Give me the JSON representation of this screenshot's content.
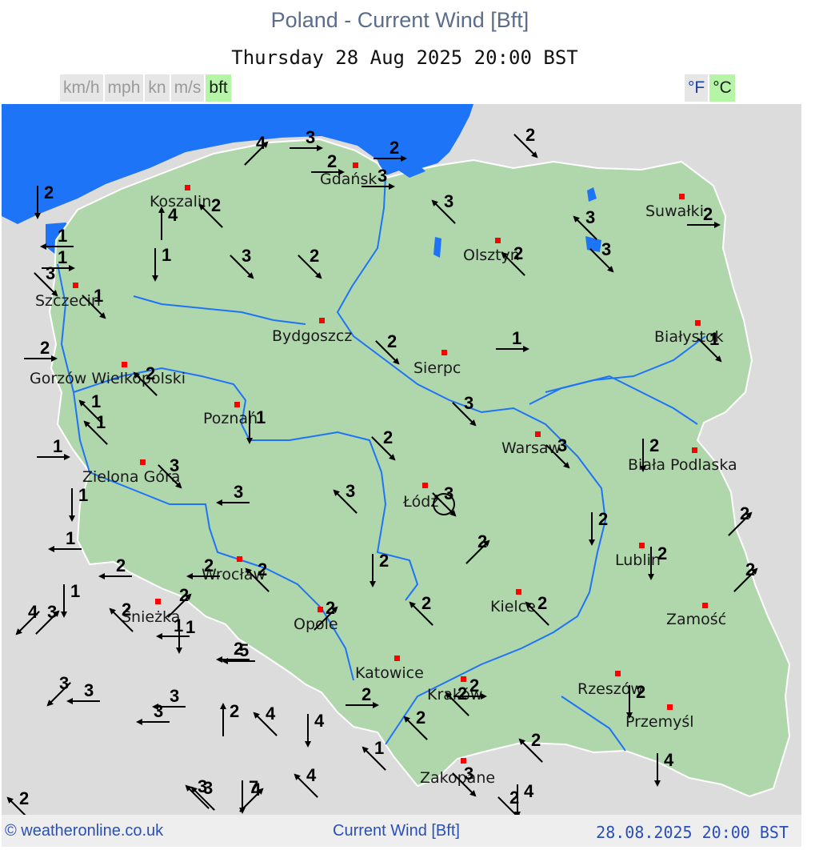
{
  "header": {
    "title": "Poland - Current Wind [Bft]",
    "datetime": "Thursday 28 Aug 2025 20:00 BST"
  },
  "units": [
    {
      "label": "km/h",
      "active": false
    },
    {
      "label": "mph",
      "active": false
    },
    {
      "label": "kn",
      "active": false
    },
    {
      "label": "m/s",
      "active": false
    },
    {
      "label": "bft",
      "active": true
    }
  ],
  "temperature_units": [
    {
      "label": "°F",
      "active": false
    },
    {
      "label": "°C",
      "active": true
    }
  ],
  "colors": {
    "land_poland": "#b0d6ac",
    "land_other": "#dcdcdc",
    "sea": "#1e74f6",
    "border": "#ffffff",
    "river": "#1e74f6",
    "city_marker": "#ff0000",
    "unit_active": "#b6f5a8"
  },
  "cities": [
    {
      "name": "Koszalin"
    },
    {
      "name": "Gdańsk"
    },
    {
      "name": "Suwałki"
    },
    {
      "name": "Olsztyn"
    },
    {
      "name": "Szczecin"
    },
    {
      "name": "Bydgoszcz"
    },
    {
      "name": "Białystok"
    },
    {
      "name": "Sierpc"
    },
    {
      "name": "Gorzów Wielkopolski"
    },
    {
      "name": "Poznań"
    },
    {
      "name": "Warsaw"
    },
    {
      "name": "Biała Podlaska"
    },
    {
      "name": "Zielona Góra"
    },
    {
      "name": "Łódź"
    },
    {
      "name": "Lublin"
    },
    {
      "name": "Wrocław"
    },
    {
      "name": "Śnieżka"
    },
    {
      "name": "Opole"
    },
    {
      "name": "Kielce"
    },
    {
      "name": "Zamość"
    },
    {
      "name": "Katowice"
    },
    {
      "name": "Kraków"
    },
    {
      "name": "Rzeszów"
    },
    {
      "name": "Przemyśl"
    },
    {
      "name": "Zakopane"
    }
  ],
  "wind_observations": [
    {
      "bft": "2",
      "direction": "SE"
    },
    {
      "bft": "3",
      "direction": "E"
    },
    {
      "bft": "4",
      "direction": "NE"
    },
    {
      "bft": "2",
      "direction": "E"
    },
    {
      "bft": "2",
      "direction": "E"
    },
    {
      "bft": "3",
      "direction": "E"
    },
    {
      "bft": "2",
      "direction": "S"
    },
    {
      "bft": "3",
      "direction": "NW"
    },
    {
      "bft": "4",
      "direction": "N"
    },
    {
      "bft": "2",
      "direction": "NW"
    },
    {
      "bft": "3",
      "direction": "NW"
    },
    {
      "bft": "2",
      "direction": "E"
    },
    {
      "bft": "1",
      "direction": "W"
    },
    {
      "bft": "1",
      "direction": "E"
    },
    {
      "bft": "2",
      "direction": "NW"
    },
    {
      "bft": "3",
      "direction": "SE"
    },
    {
      "bft": "3",
      "direction": "SE"
    },
    {
      "bft": "2",
      "direction": "SE"
    },
    {
      "bft": "3",
      "direction": "SE"
    },
    {
      "bft": "1",
      "direction": "SE"
    },
    {
      "bft": "1",
      "direction": "S"
    },
    {
      "bft": "2",
      "direction": "SE"
    },
    {
      "bft": "1",
      "direction": "E"
    },
    {
      "bft": "2",
      "direction": "E"
    },
    {
      "bft": "1",
      "direction": "SE"
    },
    {
      "bft": "2",
      "direction": "NW"
    },
    {
      "bft": "1",
      "direction": "NW"
    },
    {
      "bft": "1",
      "direction": "NW"
    },
    {
      "bft": "1",
      "direction": "S"
    },
    {
      "bft": "3",
      "direction": "SE"
    },
    {
      "bft": "2",
      "direction": "SE"
    },
    {
      "bft": "3",
      "direction": "SE"
    },
    {
      "bft": "1",
      "direction": "E"
    },
    {
      "bft": "3",
      "direction": "NW"
    },
    {
      "bft": "2",
      "direction": "S"
    },
    {
      "bft": "1",
      "direction": "S"
    },
    {
      "bft": "3",
      "direction": "W"
    },
    {
      "bft": "3",
      "direction": "SE"
    },
    {
      "bft": "3",
      "direction": "SE"
    },
    {
      "bft": "2",
      "direction": "NE"
    },
    {
      "bft": "2",
      "direction": "NE"
    },
    {
      "bft": "1",
      "direction": "W"
    },
    {
      "bft": "2",
      "direction": "W"
    },
    {
      "bft": "2",
      "direction": "NW"
    },
    {
      "bft": "2",
      "direction": "S"
    },
    {
      "bft": "2",
      "direction": "NE"
    },
    {
      "bft": "1",
      "direction": "S"
    },
    {
      "bft": "2",
      "direction": "W"
    },
    {
      "bft": "2",
      "direction": "NW"
    },
    {
      "bft": "2",
      "direction": "S"
    },
    {
      "bft": "2",
      "direction": "S"
    },
    {
      "bft": "2",
      "direction": "NE"
    },
    {
      "bft": "2",
      "direction": "NW"
    },
    {
      "bft": "2",
      "direction": "NW"
    },
    {
      "bft": "2",
      "direction": "NE"
    },
    {
      "bft": "1",
      "direction": "S"
    },
    {
      "bft": "3",
      "direction": "NE"
    },
    {
      "bft": "4",
      "direction": "SW"
    },
    {
      "bft": "1",
      "direction": "W"
    },
    {
      "bft": "2",
      "direction": "W"
    },
    {
      "bft": "5",
      "direction": "W"
    },
    {
      "bft": "4",
      "direction": "NW"
    },
    {
      "bft": "2",
      "direction": "NW"
    },
    {
      "bft": "3",
      "direction": "SW"
    },
    {
      "bft": "3",
      "direction": "W"
    },
    {
      "bft": "2",
      "direction": "E"
    },
    {
      "bft": "3",
      "direction": "W"
    },
    {
      "bft": "3",
      "direction": "W"
    },
    {
      "bft": "2",
      "direction": "N"
    },
    {
      "bft": "2",
      "direction": "E"
    },
    {
      "bft": "2",
      "direction": "S"
    },
    {
      "bft": "2",
      "direction": "NW"
    },
    {
      "bft": "4",
      "direction": "S"
    },
    {
      "bft": "2",
      "direction": "NW"
    },
    {
      "bft": "3",
      "direction": "NW"
    },
    {
      "bft": "7",
      "direction": "S"
    },
    {
      "bft": "1",
      "direction": "NW"
    },
    {
      "bft": "2",
      "direction": "NW"
    },
    {
      "bft": "4",
      "direction": "S"
    },
    {
      "bft": "3",
      "direction": "SE"
    },
    {
      "bft": "2",
      "direction": "SE"
    },
    {
      "bft": "4",
      "direction": "S"
    },
    {
      "bft": "4",
      "direction": "NW"
    },
    {
      "bft": "3",
      "direction": "NW"
    },
    {
      "bft": "4",
      "direction": "NE"
    },
    {
      "bft": "4",
      "direction": "S"
    }
  ],
  "calm_marker": {
    "label": "calm"
  },
  "footer": {
    "copyright": "© weatheronline.co.uk",
    "product": "Current Wind [Bft]",
    "timestamp": "28.08.2025 20:00 BST"
  }
}
